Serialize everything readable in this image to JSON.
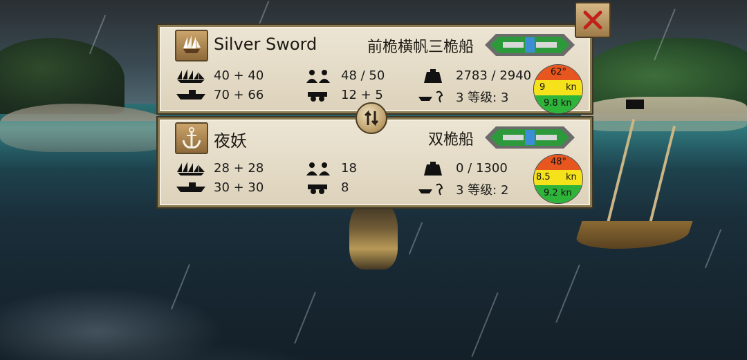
{
  "ships": [
    {
      "name": "Silver Sword",
      "class": "前桅横帆三桅船",
      "sails": "40 + 40",
      "cannons_deck": "70 + 66",
      "crew": "48 / 50",
      "guns": "12 + 5",
      "cargo": "2783 / 2940",
      "upgrades_label": "3  等级: 3",
      "speed": {
        "angle": "62°",
        "left": "9",
        "unit": "kn",
        "max": "9.8 kn"
      }
    },
    {
      "name": "夜妖",
      "class": "双桅船",
      "sails": "28 + 28",
      "cannons_deck": "30 + 30",
      "crew": "18",
      "guns": "8",
      "cargo": "0 / 1300",
      "upgrades_label": "3  等级: 2",
      "speed": {
        "angle": "48°",
        "left": "8.5",
        "unit": "kn",
        "max": "9.2 kn"
      }
    }
  ],
  "icons": {
    "close": "close-x-icon",
    "swap": "swap-arrows-icon"
  },
  "colors": {
    "panel": "#e6ddc8",
    "border": "#8a7a52",
    "speed_high": "#e8561f",
    "speed_mid": "#f5e21a",
    "speed_low": "#2fb43a",
    "close_x": "#c0221c"
  }
}
